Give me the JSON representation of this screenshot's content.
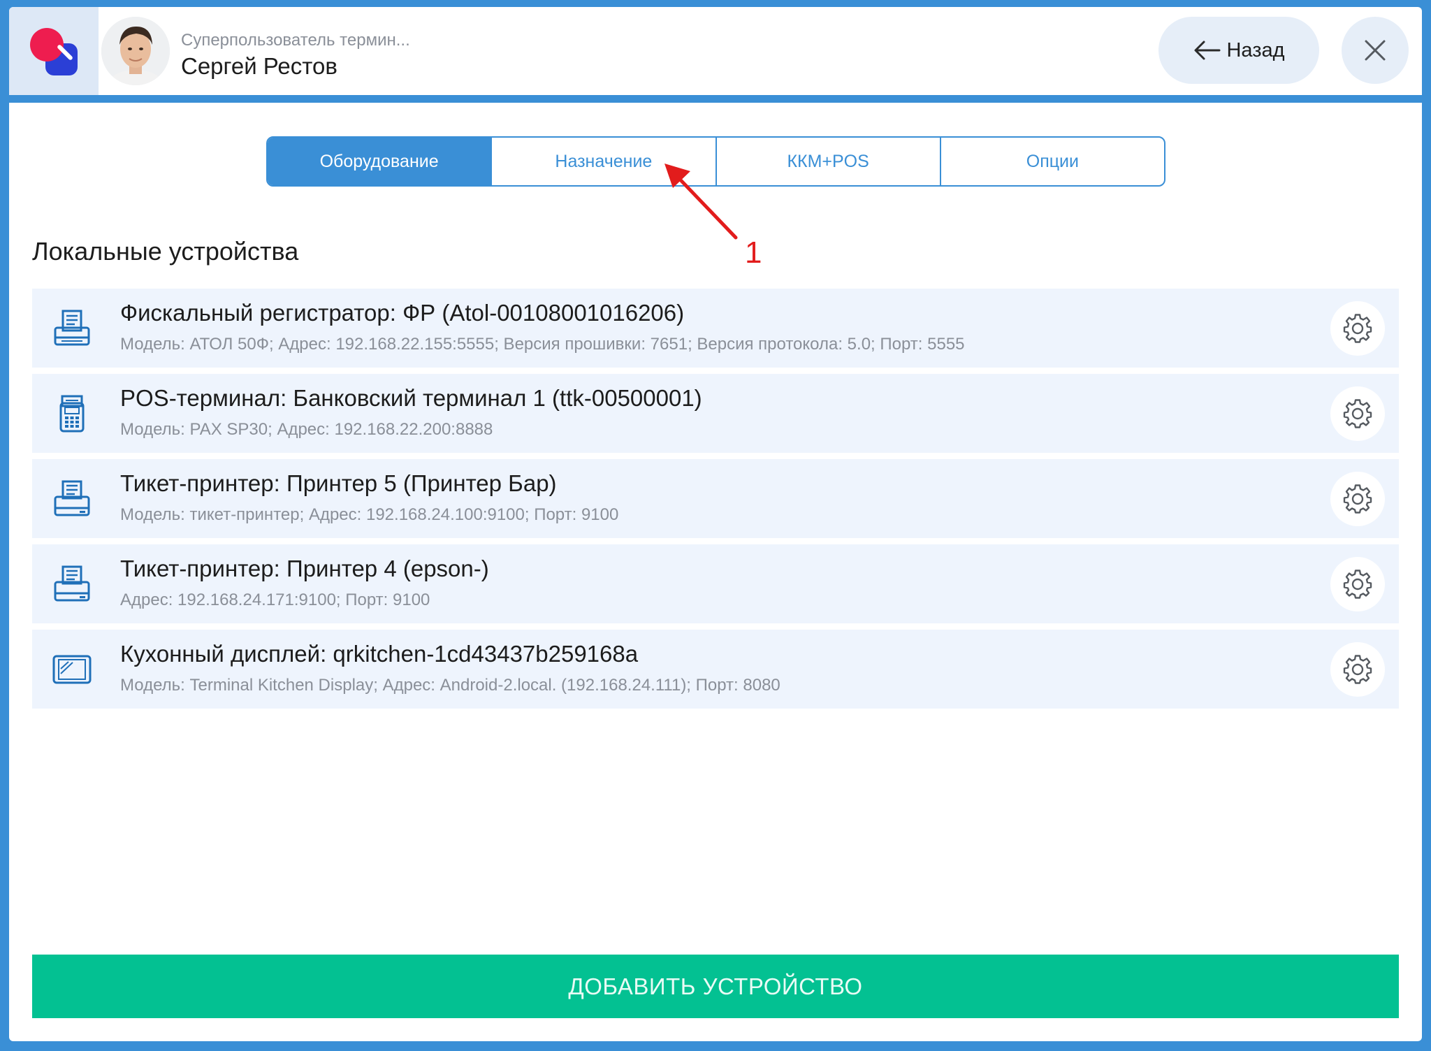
{
  "header": {
    "user_role": "Суперпользователь термин...",
    "user_name": "Сергей Рестов",
    "back_label": "Назад"
  },
  "tabs": [
    {
      "label": "Оборудование",
      "active": true
    },
    {
      "label": "Назначение",
      "active": false
    },
    {
      "label": "ККМ+POS",
      "active": false
    },
    {
      "label": "Опции",
      "active": false
    }
  ],
  "annotation": {
    "number": "1"
  },
  "section_title": "Локальные устройства",
  "devices": [
    {
      "icon": "fiscal-printer-icon",
      "title": "Фискальный регистратор: ФР (Atol-00108001016206)",
      "meta": "Модель: АТОЛ 50Ф; Адрес: 192.168.22.155:5555; Версия прошивки: 7651; Версия протокола: 5.0; Порт: 5555"
    },
    {
      "icon": "pos-terminal-icon",
      "title": "POS-терминал: Банковский терминал 1 (ttk-00500001)",
      "meta": "Модель: PAX SP30; Адрес: 192.168.22.200:8888"
    },
    {
      "icon": "ticket-printer-icon",
      "title": "Тикет-принтер: Принтер 5 (Принтер Бар)",
      "meta": "Модель: тикет-принтер; Адрес: 192.168.24.100:9100; Порт: 9100"
    },
    {
      "icon": "ticket-printer-icon",
      "title": "Тикет-принтер: Принтер 4 (epson-)",
      "meta": "Адрес: 192.168.24.171:9100; Порт: 9100"
    },
    {
      "icon": "kitchen-display-icon",
      "title": "Кухонный дисплей: qrkitchen-1cd43437b259168a",
      "meta": "Модель: Terminal Kitchen Display; Адрес: Android-2.local. (192.168.24.111); Порт: 8080"
    }
  ],
  "add_button_label": "ДОБАВИТЬ УСТРОЙСТВО",
  "colors": {
    "frame": "#3a8fd6",
    "accent": "#3a8fd6",
    "add_button": "#03c192",
    "row_bg": "#eef4fd",
    "annotation": "#e21c1c"
  }
}
